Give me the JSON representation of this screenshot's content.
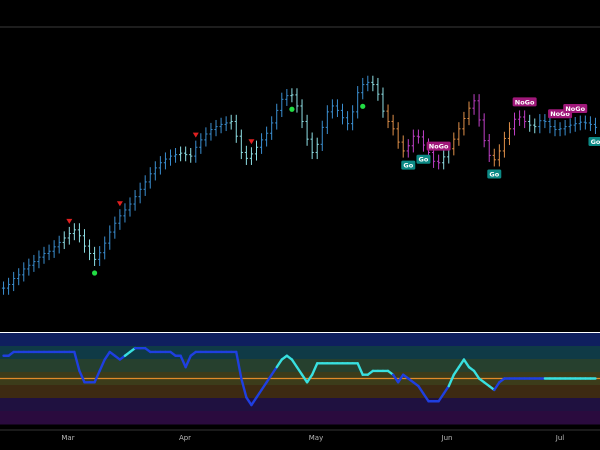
{
  "chart_data": [
    {
      "type": "ohlc",
      "x_tick_labels": [
        "Mar",
        "Apr",
        "May",
        "Jun",
        "Jul"
      ],
      "price_series": {
        "bars": 118,
        "close_path": [
          40,
          40.5,
          41.3,
          41.8,
          42.6,
          43.1,
          43.6,
          44.2,
          44.7,
          45.0,
          45.6,
          46.2,
          46.8,
          47.4,
          47.9,
          47.1,
          45.7,
          44.7,
          43.9,
          44.8,
          46.1,
          47.6,
          48.8,
          49.8,
          50.6,
          51.4,
          52.4,
          53.4,
          54.4,
          55.5,
          56.3,
          57.0,
          57.5,
          57.9,
          58.1,
          58.3,
          58.1,
          57.9,
          59.1,
          60.1,
          60.9,
          61.5,
          61.9,
          62.2,
          62.4,
          62.6,
          60.6,
          58.4,
          57.6,
          58.2,
          59.1,
          60.1,
          61.0,
          62.4,
          64.1,
          65.6,
          66.1,
          66.2,
          64.7,
          62.6,
          60.2,
          58.4,
          59.5,
          61.8,
          63.9,
          64.7,
          64.1,
          63.1,
          62.3,
          63.9,
          66.5,
          67.6,
          67.9,
          67.6,
          66.3,
          64.0,
          62.6,
          61.6,
          59.8,
          58.6,
          59.3,
          60.6,
          60.5,
          59.4,
          58.4,
          57.2,
          57.0,
          57.8,
          58.9,
          60.2,
          61.6,
          63.0,
          64.4,
          65.4,
          62.8,
          60.0,
          58.0,
          57.4,
          58.6,
          60.3,
          61.6,
          62.9,
          63.2,
          62.6,
          62.1,
          61.9,
          62.7,
          62.6,
          61.9,
          61.5,
          61.6,
          61.9,
          62.1,
          62.3,
          62.5,
          62.4,
          62.2,
          61.8
        ],
        "regime_colors": [
          "#3b8fd1",
          "#3b8fd1",
          "#3b8fd1",
          "#3b8fd1",
          "#3b8fd1",
          "#3b8fd1",
          "#3b8fd1",
          "#3b8fd1",
          "#3b8fd1",
          "#3b8fd1",
          "#3b8fd1",
          "#3b8fd1",
          "#8fe0e6",
          "#8fe0e6",
          "#8fe0e6",
          "#8fe0e6",
          "#8fe0e6",
          "#8fe0e6",
          "#8fe0e6",
          "#3b8fd1",
          "#3b8fd1",
          "#3b8fd1",
          "#3b8fd1",
          "#3b8fd1",
          "#3b8fd1",
          "#3b8fd1",
          "#3b8fd1",
          "#3b8fd1",
          "#3b8fd1",
          "#3b8fd1",
          "#3b8fd1",
          "#3b8fd1",
          "#3b8fd1",
          "#3b8fd1",
          "#3b8fd1",
          "#8fe0e6",
          "#8fe0e6",
          "#8fe0e6",
          "#3b8fd1",
          "#3b8fd1",
          "#3b8fd1",
          "#3b8fd1",
          "#3b8fd1",
          "#3b8fd1",
          "#3b8fd1",
          "#8fe0e6",
          "#8fe0e6",
          "#8fe0e6",
          "#8fe0e6",
          "#8fe0e6",
          "#8fe0e6",
          "#3b8fd1",
          "#3b8fd1",
          "#3b8fd1",
          "#3b8fd1",
          "#3b8fd1",
          "#3b8fd1",
          "#8fe0e6",
          "#8fe0e6",
          "#8fe0e6",
          "#8fe0e6",
          "#8fe0e6",
          "#8fe0e6",
          "#3b8fd1",
          "#3b8fd1",
          "#3b8fd1",
          "#3b8fd1",
          "#3b8fd1",
          "#3b8fd1",
          "#3b8fd1",
          "#3b8fd1",
          "#3b8fd1",
          "#3b8fd1",
          "#8fe0e6",
          "#8fe0e6",
          "#8fe0e6",
          "#e0904a",
          "#e0904a",
          "#e0904a",
          "#e0904a",
          "#c040c8",
          "#c040c8",
          "#c040c8",
          "#c040c8",
          "#c040c8",
          "#c040c8",
          "#c040c8",
          "#8fe0e6",
          "#8fe0e6",
          "#e0904a",
          "#e0904a",
          "#e0904a",
          "#e0904a",
          "#c040c8",
          "#c040c8",
          "#c040c8",
          "#c040c8",
          "#e0904a",
          "#e0904a",
          "#e0904a",
          "#e0904a",
          "#c040c8",
          "#c040c8",
          "#c040c8",
          "#8fe0e6",
          "#8fe0e6",
          "#3b8fd1",
          "#3b8fd1",
          "#3b8fd1",
          "#3b8fd1",
          "#3b8fd1",
          "#3b8fd1",
          "#3b8fd1",
          "#3b8fd1",
          "#3b8fd1",
          "#3b8fd1",
          "#3b8fd1",
          "#3b8fd1"
        ]
      },
      "signals": {
        "down_triangles": [
          13,
          23,
          38,
          49
        ],
        "dots": [
          18,
          57,
          71
        ],
        "badges": [
          {
            "bar": 80,
            "label": "Go",
            "color": "#0c8a86",
            "side": "below"
          },
          {
            "bar": 83,
            "label": "Go",
            "color": "#0c8a86",
            "side": "below"
          },
          {
            "bar": 86,
            "label": "NoGo",
            "color": "#a0187a",
            "side": "above"
          },
          {
            "bar": 97,
            "label": "Go",
            "color": "#0c8a86",
            "side": "below"
          },
          {
            "bar": 103,
            "label": "NoGo",
            "color": "#a0187a",
            "side": "above"
          },
          {
            "bar": 110,
            "label": "NoGo",
            "color": "#a0187a",
            "side": "above"
          },
          {
            "bar": 113,
            "label": "NoGo",
            "color": "#a0187a",
            "side": "above"
          },
          {
            "bar": 117,
            "label": "Go",
            "color": "#0c8a86",
            "side": "below"
          }
        ],
        "triangle_color": "#e02020",
        "dot_color": "#22dd44"
      }
    },
    {
      "type": "line",
      "oscillator": {
        "ylim": [
          -6,
          6
        ],
        "zero_line": 0,
        "values": [
          3,
          3,
          3.5,
          3.5,
          3.5,
          3.5,
          3.5,
          3.5,
          3.5,
          3.5,
          3.5,
          3.5,
          3.5,
          3.5,
          3.5,
          1,
          -0.5,
          -0.5,
          -0.5,
          1,
          2.5,
          3.5,
          3,
          2.5,
          3,
          3.5,
          4,
          4,
          4,
          3.5,
          3.5,
          3.5,
          3.5,
          3.5,
          3,
          3,
          1.5,
          3,
          3.5,
          3.5,
          3.5,
          3.5,
          3.5,
          3.5,
          3.5,
          3.5,
          3.5,
          0,
          -2.5,
          -3.5,
          -2.5,
          -1.5,
          -0.5,
          0.5,
          1.5,
          2.5,
          3,
          2.5,
          1.5,
          0.5,
          -0.5,
          0.5,
          2,
          2,
          2,
          2,
          2,
          2,
          2,
          2,
          2,
          0.5,
          0.5,
          1,
          1,
          1,
          1,
          0.5,
          -0.5,
          0.5,
          0,
          -0.5,
          -1,
          -2,
          -3,
          -3,
          -3,
          -2,
          -1,
          0.5,
          1.5,
          2.5,
          1.5,
          1,
          0,
          -0.5,
          -1,
          -1.5,
          -0.5,
          0,
          0,
          0,
          0,
          0,
          0,
          0,
          0,
          0,
          0,
          0,
          0,
          0,
          0,
          0,
          0,
          0,
          0,
          0
        ],
        "value_colors": [
          "#1f3fe0",
          "#1f3fe0",
          "#1f3fe0",
          "#1f3fe0",
          "#1f3fe0",
          "#1f3fe0",
          "#1f3fe0",
          "#1f3fe0",
          "#1f3fe0",
          "#1f3fe0",
          "#1f3fe0",
          "#1f3fe0",
          "#1f3fe0",
          "#1f3fe0",
          "#1f3fe0",
          "#1f3fe0",
          "#1f3fe0",
          "#1f3fe0",
          "#1f3fe0",
          "#1f3fe0",
          "#1f3fe0",
          "#1f3fe0",
          "#1f3fe0",
          "#1f3fe0",
          "#1f3fe0",
          "#38e0e0",
          "#38e0e0",
          "#1f3fe0",
          "#1f3fe0",
          "#1f3fe0",
          "#1f3fe0",
          "#1f3fe0",
          "#1f3fe0",
          "#1f3fe0",
          "#1f3fe0",
          "#1f3fe0",
          "#1f3fe0",
          "#1f3fe0",
          "#1f3fe0",
          "#1f3fe0",
          "#1f3fe0",
          "#1f3fe0",
          "#1f3fe0",
          "#1f3fe0",
          "#1f3fe0",
          "#1f3fe0",
          "#1f3fe0",
          "#1f3fe0",
          "#1f3fe0",
          "#1f3fe0",
          "#1f3fe0",
          "#1f3fe0",
          "#1f3fe0",
          "#1f3fe0",
          "#1f3fe0",
          "#38e0e0",
          "#38e0e0",
          "#38e0e0",
          "#38e0e0",
          "#38e0e0",
          "#38e0e0",
          "#38e0e0",
          "#38e0e0",
          "#38e0e0",
          "#38e0e0",
          "#38e0e0",
          "#38e0e0",
          "#38e0e0",
          "#38e0e0",
          "#38e0e0",
          "#38e0e0",
          "#38e0e0",
          "#38e0e0",
          "#38e0e0",
          "#38e0e0",
          "#38e0e0",
          "#38e0e0",
          "#38e0e0",
          "#1f3fe0",
          "#1f3fe0",
          "#1f3fe0",
          "#1f3fe0",
          "#1f3fe0",
          "#1f3fe0",
          "#1f3fe0",
          "#1f3fe0",
          "#1f3fe0",
          "#1f3fe0",
          "#1f3fe0",
          "#38e0e0",
          "#38e0e0",
          "#38e0e0",
          "#38e0e0",
          "#38e0e0",
          "#38e0e0",
          "#38e0e0",
          "#38e0e0",
          "#38e0e0",
          "#1f3fe0",
          "#1f3fe0",
          "#1f3fe0",
          "#1f3fe0",
          "#1f3fe0",
          "#1f3fe0",
          "#1f3fe0",
          "#1f3fe0",
          "#1f3fe0",
          "#1f3fe0",
          "#38e0e0",
          "#38e0e0",
          "#38e0e0",
          "#38e0e0",
          "#38e0e0",
          "#38e0e0",
          "#38e0e0",
          "#38e0e0",
          "#38e0e0",
          "#38e0e0"
        ],
        "zone_colors": [
          "#0f1f5e",
          "#0f3a46",
          "#26402e",
          "#3c3c1a",
          "#3d2a12",
          "#1f1140",
          "#2a0b3e"
        ],
        "zero_line_color": "#e08a2a"
      }
    }
  ]
}
